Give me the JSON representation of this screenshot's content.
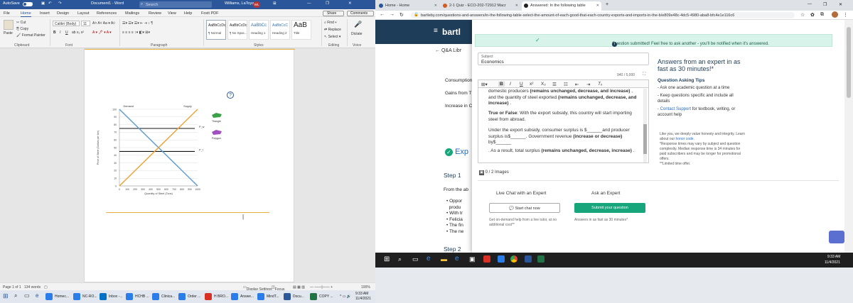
{
  "word": {
    "autosave": "AutoSave",
    "autosave_state": "Off",
    "doc_title": "Document1  -  Word",
    "search_label": "Search",
    "user_name": "Williams, LaToya",
    "user_initials": "WL",
    "tabs": [
      "File",
      "Home",
      "Insert",
      "Design",
      "Layout",
      "References",
      "Mailings",
      "Review",
      "View",
      "Help",
      "Foxit PDF"
    ],
    "share": "Share",
    "comments": "Comments",
    "ribbon": {
      "paste": "Paste",
      "cut": "Cut",
      "copy": "Copy",
      "format_painter": "Format Painter",
      "clipboard": "Clipboard",
      "font_name": "Calibri (Body)",
      "font_size": "11",
      "font": "Font",
      "paragraph": "Paragraph",
      "styles": "Styles",
      "style_sample": "AaBbCcDc",
      "style_sample2": "AaBbCcDc",
      "style_sample3": "AaBbCc",
      "style_sample4": "AaBbCcC",
      "style_sample5": "AaB",
      "style_names": [
        "¶ Normal",
        "¶ No Spac...",
        "Heading 1",
        "Heading 2",
        "Title"
      ],
      "find": "Find",
      "replace": "Replace",
      "select": "Select",
      "editing": "Editing",
      "dictate": "Dictate",
      "voice": "Voice"
    },
    "status": {
      "page": "Page 1 of 1",
      "words": "134 words",
      "display_settings": "Display Settings",
      "focus": "Focus",
      "zoom": "100%"
    },
    "taskbar": [
      "Homec...",
      "NC-RO...",
      "Inbox -...",
      "HCHB ...",
      "Clinica...",
      "Order ...",
      "H BRO...",
      "Answe...",
      "MindT...",
      "Docu...",
      "COPY ..."
    ],
    "clock_time": "9:33 AM",
    "clock_date": "11/4/2021"
  },
  "chart_data": {
    "type": "line",
    "title": "",
    "xlabel": "Quantity of Steel (Tons)",
    "ylabel": "Price of Steel (Dollars per ton)",
    "xlim": [
      0,
      1000
    ],
    "ylim": [
      0,
      100
    ],
    "xticks": [
      0,
      100,
      200,
      300,
      400,
      500,
      600,
      700,
      800,
      900,
      1000
    ],
    "yticks": [
      0,
      10,
      20,
      30,
      40,
      50,
      60,
      70,
      80,
      90,
      100
    ],
    "series": [
      {
        "name": "Demand",
        "color": "#5b9bd5",
        "x": [
          0,
          1000
        ],
        "y": [
          100,
          0
        ]
      },
      {
        "name": "Supply",
        "color": "#f0a030",
        "x": [
          0,
          1000
        ],
        "y": [
          0,
          100
        ]
      }
    ],
    "hlines": [
      {
        "y": 75,
        "label": "P_w"
      },
      {
        "y": 45,
        "label": "P_t"
      }
    ],
    "series_labels": [
      "Demand",
      "Supply"
    ],
    "legend": [
      {
        "label": "Triangle",
        "color": "#3aa04a"
      },
      {
        "label": "Polygon",
        "color": "#a050c0"
      }
    ],
    "legend_placement": "right"
  },
  "browser": {
    "tabs": [
      {
        "label": "Home - Home",
        "color": "#2b579a"
      },
      {
        "label": "2-1 Quiz - ECO-202-T2912 Macr",
        "color": "#d45a1f"
      },
      {
        "label": "Answered: In the following table",
        "color": "#222"
      }
    ],
    "url": "bartleby.com/questions-and-answers/in-the-following-table-select-the-amount-of-each-good-that-each-country-exports-and-imports-in-the-b/e809e48c-4dc5-4980-aba8-bfc4e1e116c6",
    "header_logo": "bartl",
    "back_link": "Q&A Libr",
    "bg_text": {
      "consumption": "Consumption",
      "gains": "Gains from T",
      "increase": "Increase in C",
      "exp": "Exp",
      "step1": "Step 1",
      "from_the": "From the ab",
      "bullets": [
        "Oppor",
        "produ",
        "With tr",
        "Felicia",
        "The fin",
        "The ne"
      ],
      "step2": "Step 2"
    },
    "banner": "Question submitted! Feel free to ask another - you'll be notified when it's answered.",
    "subject_label": "Subject",
    "subject_value": "Economics",
    "char_count": "940 / 5,000",
    "editor_lines": {
      "l1a": "domestic producers  ",
      "l1b": "(remains unchanged, decrease, and increase)",
      "l1c": " ,",
      "l2a": "and the quantity of steel exported  ",
      "l2b": "(remains unchanged, decrease, and increase)",
      "l2c": " .",
      "tf_bold": "True or False",
      "tf_rest": ": With the export subsidy, this country will start importing steel from abroad.",
      "p3": "Under the export subsidy, consumer surplus is $______and producer surplus is$______. Government revenue ",
      "p3b": "(increase or decrease)",
      "p3c": " by$______",
      "p4a": ". As a result, total surplus ",
      "p4b": "(remains unchanged, decrease, increase)",
      "p4c": " ."
    },
    "images_count": "0 / 2 Images",
    "right": {
      "headline": "Answers from an expert in as fast as 30 minutes!*",
      "tips_title": "Question Asking Tips",
      "tips": [
        "- Ask one academic question at a time",
        "- Keep questions specific and include all details"
      ],
      "contact_link": "- Contact Support",
      "contact_rest": " for textbook, writing, or account help",
      "honesty": "Like you, we deeply value honesty and integrity. Learn about our ",
      "honor_code": "honor code",
      "response": "*Response times may vary by subject and question complexity. Median response time is 34 minutes for paid subscribers and may be longer for promotional offers.",
      "limited": "**Limited time offer."
    },
    "chat": {
      "live_title": "Live Chat with an Expert",
      "live_btn": "Start chat now",
      "live_note": "Get on-demand help from a live tutor, at no additional cost**",
      "expert_title": "Ask an Expert",
      "expert_btn": "Submit your question",
      "expert_note": "Answers in as fast as 30 minutes*"
    }
  },
  "desktop": {
    "clock_time": "9:33 AM",
    "clock_date": "11/4/2021"
  }
}
